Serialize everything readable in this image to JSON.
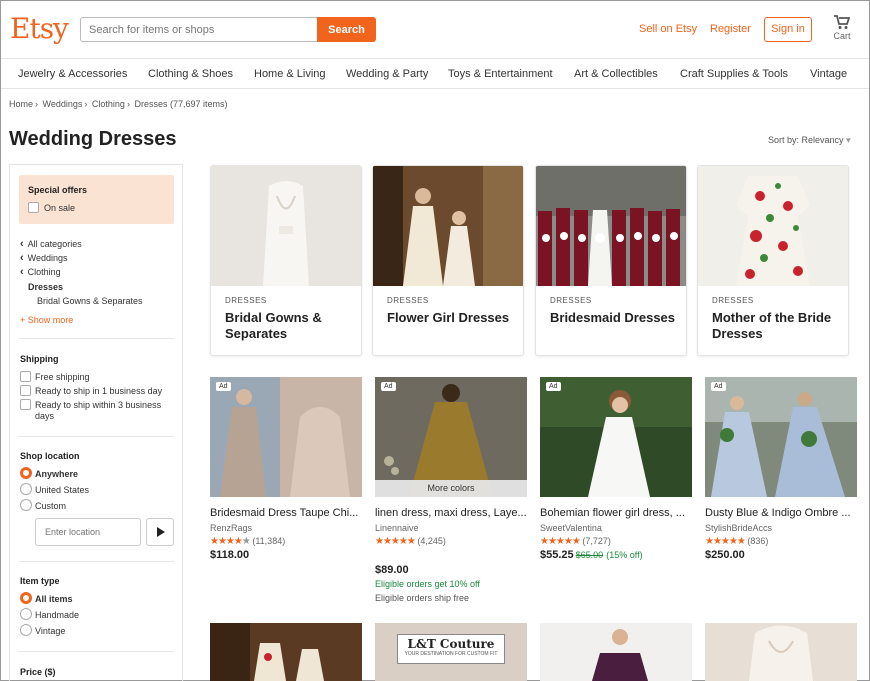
{
  "header": {
    "logo": "Etsy",
    "search_placeholder": "Search for items or shops",
    "search_button": "Search",
    "sell": "Sell on Etsy",
    "register": "Register",
    "sign_in": "Sign in",
    "cart": "Cart"
  },
  "categories": [
    "Jewelry & Accessories",
    "Clothing & Shoes",
    "Home & Living",
    "Wedding & Party",
    "Toys & Entertainment",
    "Art & Collectibles",
    "Craft Supplies & Tools",
    "Vintage"
  ],
  "breadcrumb": [
    "Home",
    "Weddings",
    "Clothing",
    "Dresses (77,697 items)"
  ],
  "page_title": "Wedding Dresses",
  "sort_label": "Sort by: Relevancy",
  "sidebar": {
    "special_offers": "Special offers",
    "on_sale": "On sale",
    "nav": [
      "All categories",
      "Weddings",
      "Clothing"
    ],
    "current": "Dresses",
    "sub": "Bridal Gowns & Separates",
    "show_more": "+ Show more",
    "shipping": {
      "title": "Shipping",
      "options": [
        "Free shipping",
        "Ready to ship in 1 business day",
        "Ready to ship within 3 business",
        "days"
      ]
    },
    "location": {
      "title": "Shop location",
      "options": [
        "Anywhere",
        "United States",
        "Custom"
      ],
      "placeholder": "Enter location"
    },
    "item_type": {
      "title": "Item type",
      "options": [
        "All items",
        "Handmade",
        "Vintage"
      ]
    },
    "price_title": "Price ($)"
  },
  "tiles": [
    {
      "small": "DRESSES",
      "name": "Bridal Gowns & Separates"
    },
    {
      "small": "DRESSES",
      "name": "Flower Girl Dresses"
    },
    {
      "small": "DRESSES",
      "name": "Bridesmaid Dresses"
    },
    {
      "small": "DRESSES",
      "name": "Mother of the Bride Dresses"
    }
  ],
  "listings": [
    {
      "ad": "Ad",
      "title": "Bridesmaid Dress Taupe Chi...",
      "shop": "RenzRags",
      "stars": "★★★★",
      "half": "★",
      "reviews": "(11,384)",
      "price": "$118.00"
    },
    {
      "ad": "Ad",
      "more_colors": "More colors",
      "title": "linen dress, maxi dress, Laye...",
      "shop": "Linennaive",
      "stars": "★★★★★",
      "reviews": "(4,245)",
      "price": "$89.00",
      "promo1": "Eligible orders get 10% off",
      "promo2": "Eligible orders ship free"
    },
    {
      "ad": "Ad",
      "title": "Bohemian flower girl dress, ...",
      "shop": "SweetValentina",
      "stars": "★★★★★",
      "reviews": "(7,727)",
      "price": "$55.25",
      "old_price": "$65.00",
      "discount": "(15% off)"
    },
    {
      "ad": "Ad",
      "title": "Dusty Blue & Indigo Ombre ...",
      "shop": "StylishBrideAccs",
      "stars": "★★★★★",
      "reviews": "(836)",
      "price": "$250.00"
    }
  ],
  "bottom_logo": {
    "main": "L&T Couture",
    "sub": "YOUR DESTINATION FOR CUSTOM FIT"
  },
  "colors": {
    "accent": "#F1641E",
    "offers_bg": "#fbe3d3",
    "sale_green": "#1a8b3d"
  }
}
